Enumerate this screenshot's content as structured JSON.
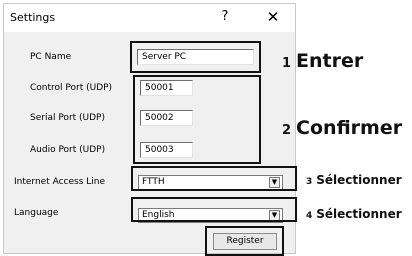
{
  "dialog": {
    "title": "Settings",
    "help_label": "?",
    "close_label": "✕"
  },
  "fields": {
    "pc_name": {
      "label": "PC Name",
      "value": "Server PC"
    },
    "control_port": {
      "label": "Control Port (UDP)",
      "value": "50001"
    },
    "serial_port": {
      "label": "Serial Port (UDP)",
      "value": "50002"
    },
    "audio_port": {
      "label": "Audio Port (UDP)",
      "value": "50003"
    },
    "internet_access_line": {
      "label": "Internet Access Line",
      "selected": "FTTH"
    },
    "language": {
      "label": "Language",
      "selected": "English"
    }
  },
  "buttons": {
    "register": "Register"
  },
  "annotations": [
    {
      "number": "1",
      "text": "Entrer"
    },
    {
      "number": "2",
      "text": "Confirmer"
    },
    {
      "number": "3",
      "text": "Sélectionner"
    },
    {
      "number": "4",
      "text": "Sélectionner"
    }
  ],
  "colors": {
    "dialog_bg": "#f0f0f0",
    "highlight_border": "#111111"
  }
}
